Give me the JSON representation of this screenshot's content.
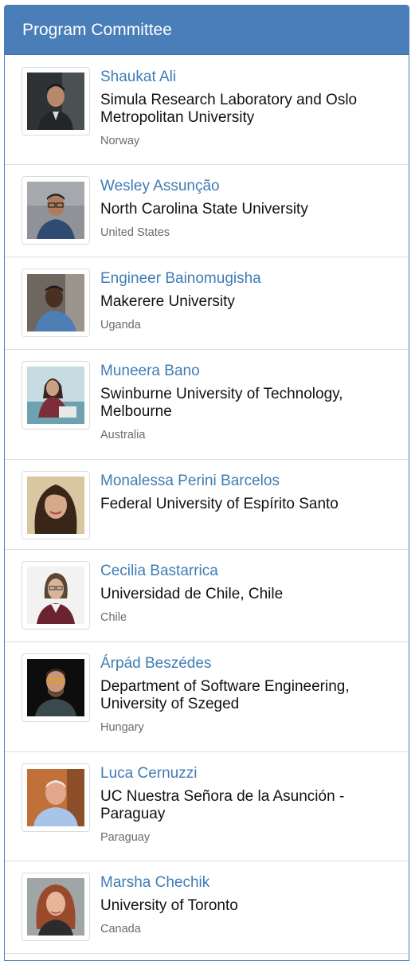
{
  "panel": {
    "title": "Program Committee"
  },
  "members": [
    {
      "name": "Shaukat Ali",
      "affiliation": "Simula Research Laboratory and Oslo Metropolitan University",
      "country": "Norway"
    },
    {
      "name": "Wesley Assunção",
      "affiliation": "North Carolina State University",
      "country": "United States"
    },
    {
      "name": "Engineer Bainomugisha",
      "affiliation": "Makerere University",
      "country": "Uganda"
    },
    {
      "name": "Muneera Bano",
      "affiliation": "Swinburne University of Technology, Melbourne",
      "country": "Australia"
    },
    {
      "name": "Monalessa Perini Barcelos",
      "affiliation": "Federal University of Espírito Santo",
      "country": ""
    },
    {
      "name": "Cecilia Bastarrica",
      "affiliation": "Universidad de Chile, Chile",
      "country": "Chile"
    },
    {
      "name": "Árpád Beszédes",
      "affiliation": "Department of Software Engineering, University of Szeged",
      "country": "Hungary"
    },
    {
      "name": "Luca Cernuzzi",
      "affiliation": "UC Nuestra Señora de la Asunción - Paraguay",
      "country": "Paraguay"
    },
    {
      "name": "Marsha Chechik",
      "affiliation": "University of Toronto",
      "country": "Canada"
    }
  ],
  "colors": {
    "header": "#4a7eb8",
    "name_link": "#3f7cb5",
    "divider": "#dddddd"
  }
}
